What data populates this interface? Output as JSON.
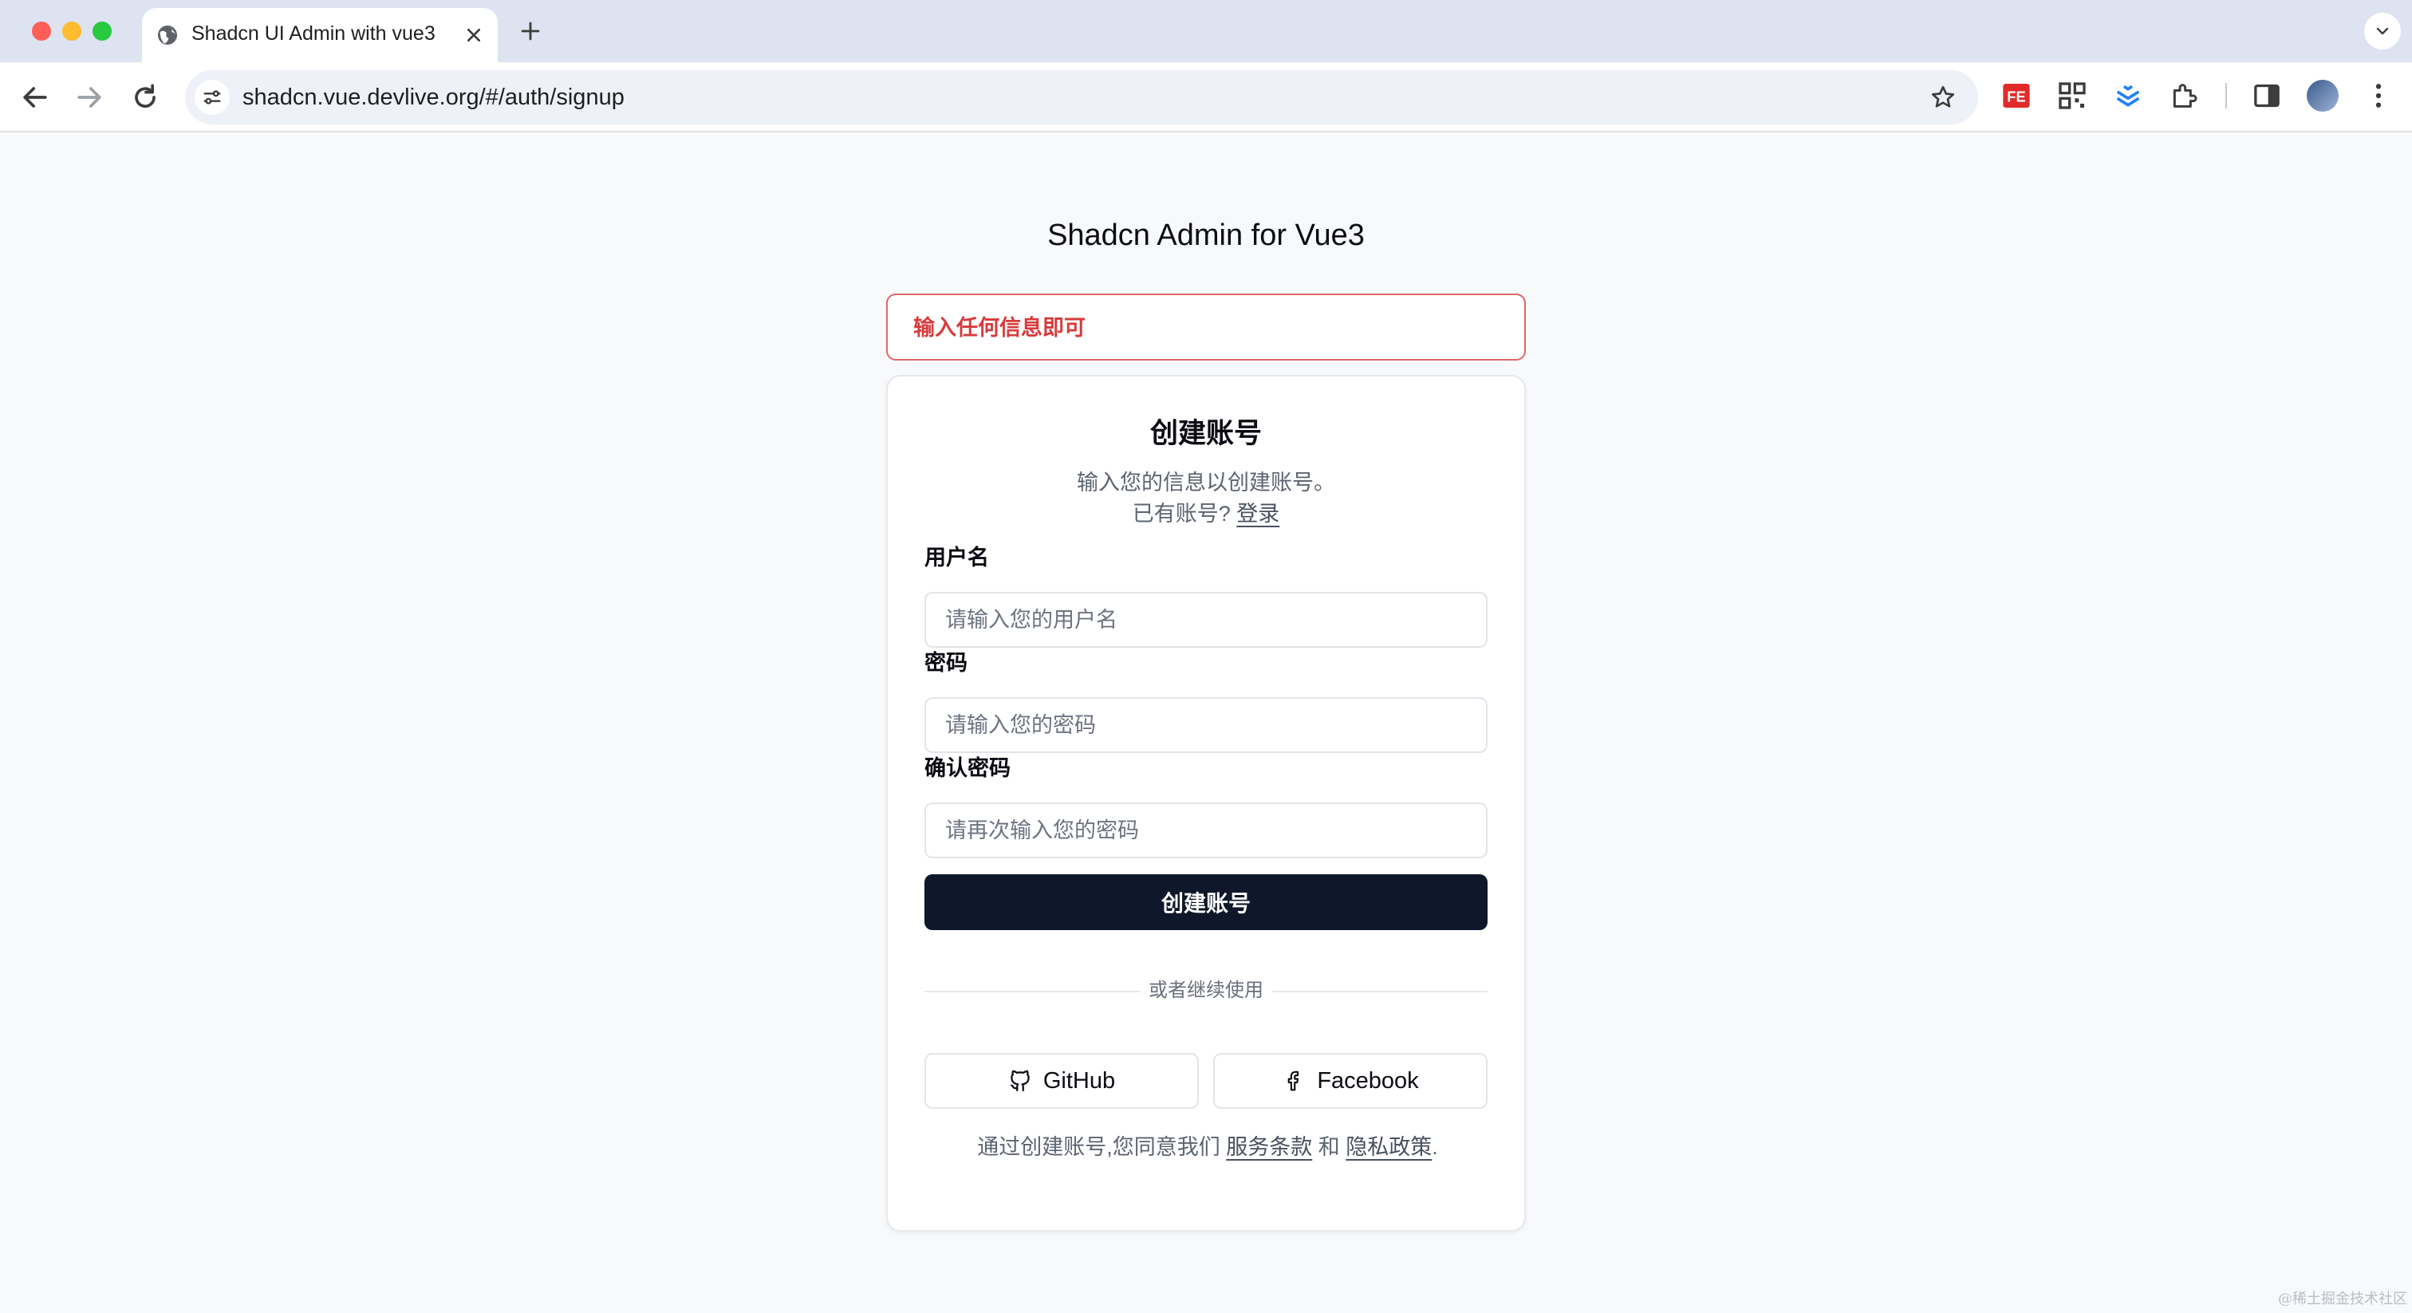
{
  "browser": {
    "tab_title": "Shadcn UI Admin with vue3",
    "url": "shadcn.vue.devlive.org/#/auth/signup",
    "icons": [
      "globe-icon",
      "close-icon",
      "plus-icon",
      "chevron-down-icon",
      "back-arrow-icon",
      "forward-arrow-icon",
      "reload-icon",
      "site-settings-icon",
      "star-icon",
      "fe-extension-icon",
      "qr-extension-icon",
      "layers-extension-icon",
      "puzzle-icon",
      "sidebar-icon",
      "profile-avatar",
      "kebab-menu-icon"
    ],
    "ext_fe_label": "FE"
  },
  "page": {
    "title": "Shadcn Admin for Vue3",
    "alert": "输入任何信息即可"
  },
  "card": {
    "title": "创建账号",
    "description": "输入您的信息以创建账号。",
    "have_account": "已有账号?",
    "login_link": "登录",
    "username_label": "用户名",
    "username_placeholder": "请输入您的用户名",
    "password_label": "密码",
    "password_placeholder": "请输入您的密码",
    "confirm_label": "确认密码",
    "confirm_placeholder": "请再次输入您的密码",
    "submit_label": "创建账号",
    "separator": "或者继续使用",
    "github_label": "GitHub",
    "facebook_label": "Facebook",
    "terms_prefix": "通过创建账号,您同意我们",
    "terms_link": "服务条款",
    "terms_and": "和",
    "privacy_link": "隐私政策",
    "terms_suffix": "."
  },
  "watermark": "@稀土掘金技术社区",
  "colors": {
    "alert_text": "#d63b3b",
    "alert_border": "#e06666",
    "primary_button": "#0f172a",
    "page_bg": "#f8f9fb",
    "tab_bar": "#dde3f1"
  }
}
